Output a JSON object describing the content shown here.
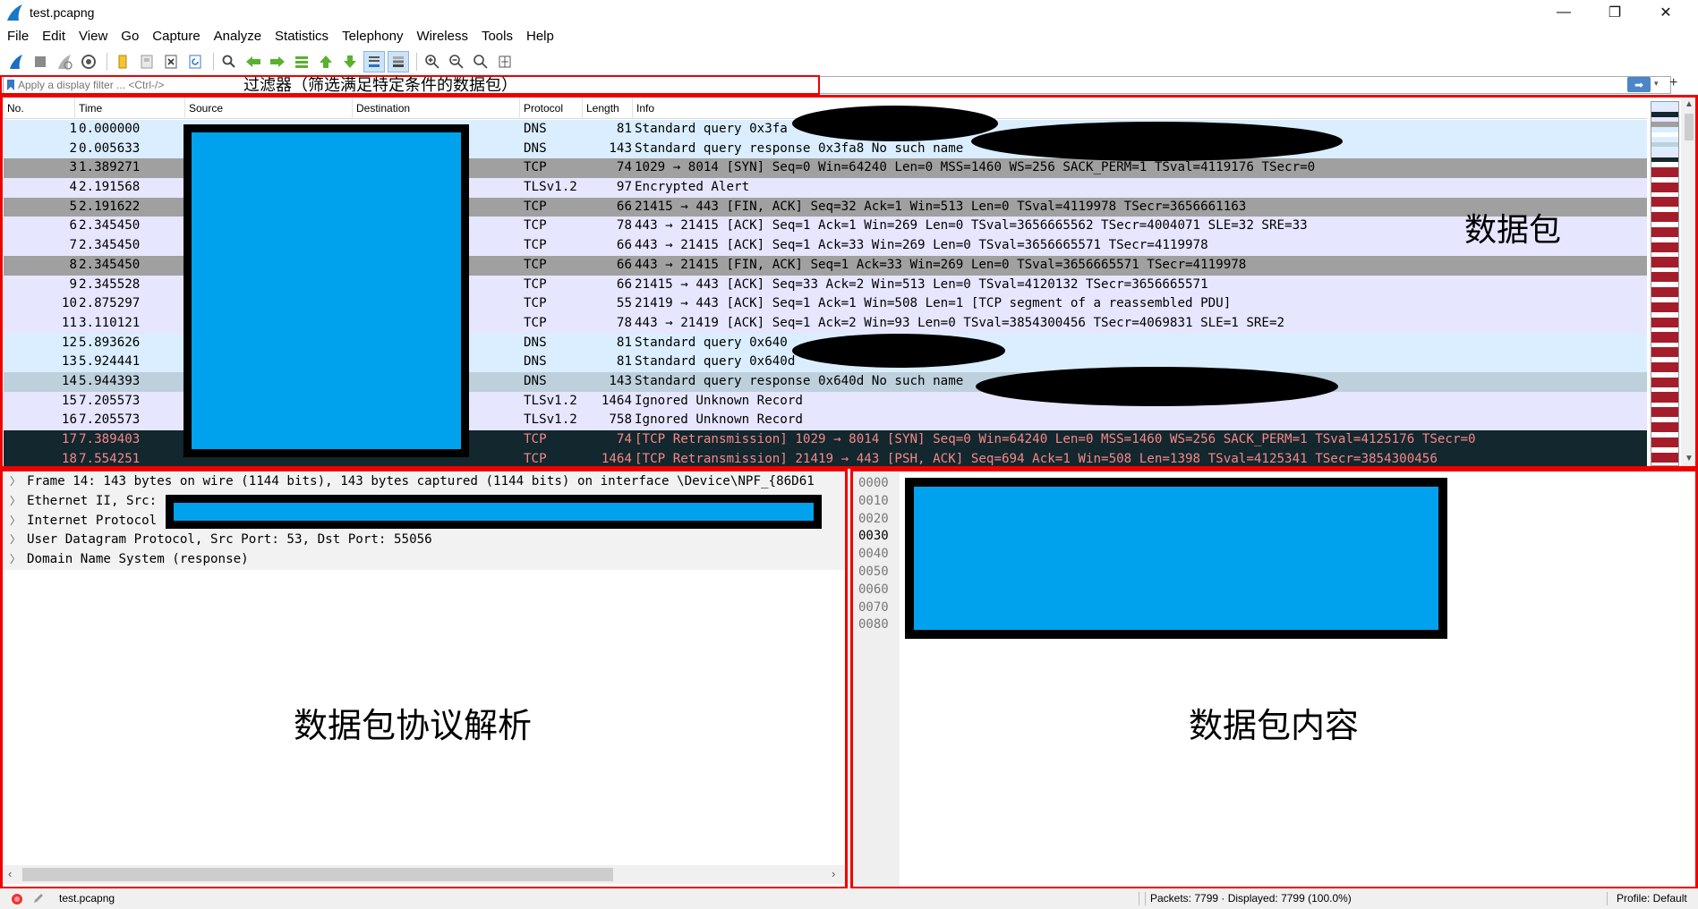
{
  "window": {
    "title": "test.pcapng",
    "controls": {
      "minimize": "—",
      "maximize": "❐",
      "close": "✕"
    }
  },
  "menu": [
    "File",
    "Edit",
    "View",
    "Go",
    "Capture",
    "Analyze",
    "Statistics",
    "Telephony",
    "Wireless",
    "Tools",
    "Help"
  ],
  "toolbar": {
    "icons": [
      "start-capture-icon",
      "stop-capture-icon",
      "restart-capture-icon",
      "capture-options-icon",
      "open-file-icon",
      "save-file-icon",
      "close-file-icon",
      "reload-file-icon",
      "find-packet-icon",
      "go-back-icon",
      "go-forward-icon",
      "go-to-packet-icon",
      "first-packet-icon",
      "last-packet-icon",
      "autoscroll-icon",
      "colorize-icon",
      "zoom-in-icon",
      "zoom-out-icon",
      "zoom-normal-icon",
      "resize-columns-icon"
    ]
  },
  "filter": {
    "placeholder": "Apply a display filter ... <Ctrl-/>",
    "annotation": "过滤器（筛选满足特定条件的数据包）",
    "apply_arrow": "➡",
    "dropdown": "▾",
    "add": "+"
  },
  "packet_list": {
    "columns": [
      "No.",
      "Time",
      "Source",
      "Destination",
      "Protocol",
      "Length",
      "Info"
    ],
    "annotation": "数据包",
    "colors": {
      "dns": "#daeeff",
      "tcp": "#e7e6ff",
      "tcp_fin": "#a0a0a0",
      "selected": "#bdd0dc",
      "bad": "#12272e",
      "bad_text": "#f78787"
    },
    "rows": [
      {
        "no": "1",
        "time": "0.000000",
        "proto": "DNS",
        "len": "81",
        "info": "Standard query 0x3fa",
        "style": "dns"
      },
      {
        "no": "2",
        "time": "0.005633",
        "proto": "DNS",
        "len": "143",
        "info": "Standard query response 0x3fa8 No such name",
        "style": "dns"
      },
      {
        "no": "3",
        "time": "1.389271",
        "proto": "TCP",
        "len": "74",
        "info": "1029 → 8014 [SYN] Seq=0 Win=64240 Len=0 MSS=1460 WS=256 SACK_PERM=1 TSval=4119176 TSecr=0",
        "style": "tcp_fin"
      },
      {
        "no": "4",
        "time": "2.191568",
        "proto": "TLSv1.2",
        "len": "97",
        "info": "Encrypted Alert",
        "style": "tcp"
      },
      {
        "no": "5",
        "time": "2.191622",
        "proto": "TCP",
        "len": "66",
        "info": "21415 → 443 [FIN, ACK] Seq=32 Ack=1 Win=513 Len=0 TSval=4119978 TSecr=3656661163",
        "style": "tcp_fin"
      },
      {
        "no": "6",
        "time": "2.345450",
        "proto": "TCP",
        "len": "78",
        "info": "443 → 21415 [ACK] Seq=1 Ack=1 Win=269 Len=0 TSval=3656665562 TSecr=4004071 SLE=32 SRE=33",
        "style": "tcp"
      },
      {
        "no": "7",
        "time": "2.345450",
        "proto": "TCP",
        "len": "66",
        "info": "443 → 21415 [ACK] Seq=1 Ack=33 Win=269 Len=0 TSval=3656665571 TSecr=4119978",
        "style": "tcp"
      },
      {
        "no": "8",
        "time": "2.345450",
        "proto": "TCP",
        "len": "66",
        "info": "443 → 21415 [FIN, ACK] Seq=1 Ack=33 Win=269 Len=0 TSval=3656665571 TSecr=4119978",
        "style": "tcp_fin"
      },
      {
        "no": "9",
        "time": "2.345528",
        "proto": "TCP",
        "len": "66",
        "info": "21415 → 443 [ACK] Seq=33 Ack=2 Win=513 Len=0 TSval=4120132 TSecr=3656665571",
        "style": "tcp"
      },
      {
        "no": "10",
        "time": "2.875297",
        "proto": "TCP",
        "len": "55",
        "info": "21419 → 443 [ACK] Seq=1 Ack=1 Win=508 Len=1 [TCP segment of a reassembled PDU]",
        "style": "tcp"
      },
      {
        "no": "11",
        "time": "3.110121",
        "proto": "TCP",
        "len": "78",
        "info": "443 → 21419 [ACK] Seq=1 Ack=2 Win=93 Len=0 TSval=3854300456 TSecr=4069831 SLE=1 SRE=2",
        "style": "tcp"
      },
      {
        "no": "12",
        "time": "5.893626",
        "proto": "DNS",
        "len": "81",
        "info": "Standard query 0x640",
        "style": "dns"
      },
      {
        "no": "13",
        "time": "5.924441",
        "proto": "DNS",
        "len": "81",
        "info": "Standard query 0x640d",
        "style": "dns"
      },
      {
        "no": "14",
        "time": "5.944393",
        "proto": "DNS",
        "len": "143",
        "info": "Standard query response 0x640d No such name",
        "style": "selected"
      },
      {
        "no": "15",
        "time": "7.205573",
        "proto": "TLSv1.2",
        "len": "1464",
        "info": "Ignored Unknown Record",
        "style": "tcp"
      },
      {
        "no": "16",
        "time": "7.205573",
        "proto": "TLSv1.2",
        "len": "758",
        "info": "Ignored Unknown Record",
        "style": "tcp"
      },
      {
        "no": "17",
        "time": "7.389403",
        "proto": "TCP",
        "len": "74",
        "info": "[TCP Retransmission] 1029 → 8014 [SYN] Seq=0 Win=64240 Len=0 MSS=1460 WS=256 SACK_PERM=1 TSval=4125176 TSecr=0",
        "style": "bad"
      },
      {
        "no": "18",
        "time": "7.554251",
        "proto": "TCP",
        "len": "1464",
        "info": "[TCP Retransmission] 21419 → 443 [PSH, ACK] Seq=694 Ack=1 Win=508 Len=1398 TSval=4125341 TSecr=3854300456",
        "style": "bad"
      }
    ]
  },
  "details": {
    "annotation": "数据包协议解析",
    "rows": [
      "Frame 14: 143 bytes on wire (1144 bits), 143 bytes captured (1144 bits) on interface \\Device\\NPF_{86D61",
      "Ethernet II, Src:",
      "Internet Protocol",
      "User Datagram Protocol, Src Port: 53, Dst Port: 55056",
      "Domain Name System (response)"
    ],
    "chevron": "〉",
    "scroll_left": "‹",
    "scroll_right": "›"
  },
  "bytes": {
    "annotation": "数据包内容",
    "offsets": [
      "0000",
      "0010",
      "0020",
      "0030",
      "0040",
      "0050",
      "0060",
      "0070",
      "0080"
    ]
  },
  "status": {
    "file": "test.pcapng",
    "packets": "Packets: 7799 · Displayed: 7799 (100.0%)",
    "profile": "Profile: Default"
  }
}
